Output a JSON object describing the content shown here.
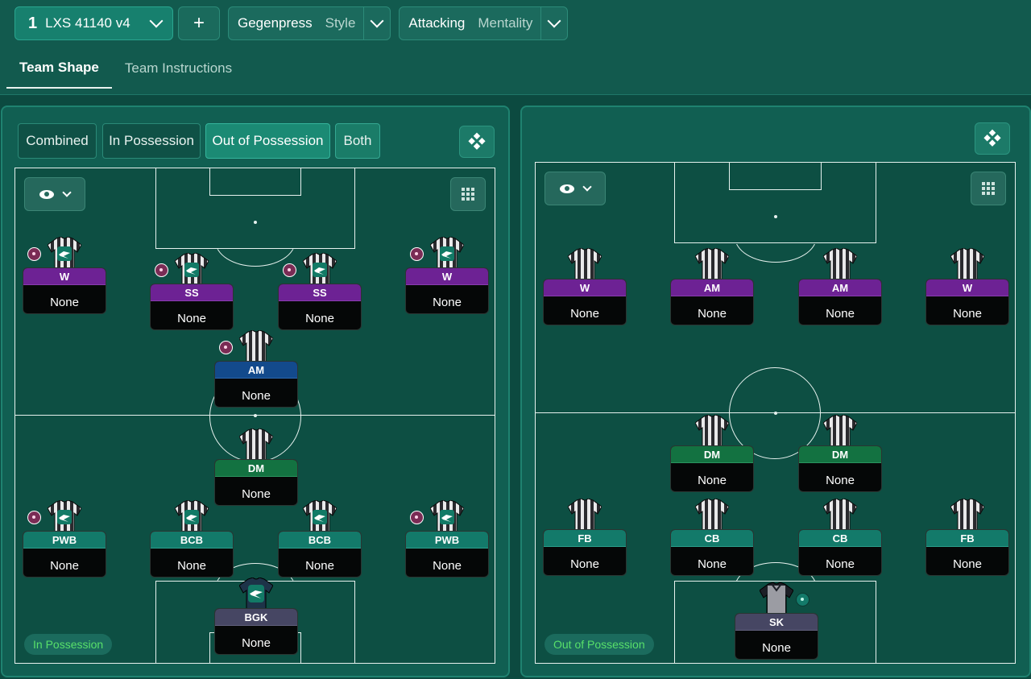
{
  "header": {
    "tactic": {
      "number": "1",
      "name": "LXS 41140 v4"
    },
    "add_label": "+",
    "style_dropdown": {
      "value": "Gegenpress",
      "label": "Style"
    },
    "mentality_dropdown": {
      "value": "Attacking",
      "label": "Mentality"
    },
    "tabs": [
      {
        "label": "Team Shape",
        "active": true
      },
      {
        "label": "Team Instructions",
        "active": false
      }
    ]
  },
  "left_panel": {
    "segments": [
      {
        "label": "Combined",
        "active": false
      },
      {
        "label": "In Possession",
        "active": false
      },
      {
        "label": "Out of Possession",
        "active": true
      },
      {
        "label": "Both",
        "active": false
      }
    ],
    "phase_label": "In Possession",
    "players": [
      {
        "role": "W",
        "duty": "None",
        "color": "purple"
      },
      {
        "role": "SS",
        "duty": "None",
        "color": "purple"
      },
      {
        "role": "SS",
        "duty": "None",
        "color": "purple"
      },
      {
        "role": "W",
        "duty": "None",
        "color": "purple"
      },
      {
        "role": "AM",
        "duty": "None",
        "color": "blue"
      },
      {
        "role": "DM",
        "duty": "None",
        "color": "green"
      },
      {
        "role": "PWB",
        "duty": "None",
        "color": "teal"
      },
      {
        "role": "BCB",
        "duty": "None",
        "color": "teal"
      },
      {
        "role": "BCB",
        "duty": "None",
        "color": "teal"
      },
      {
        "role": "PWB",
        "duty": "None",
        "color": "teal"
      },
      {
        "role": "BGK",
        "duty": "None",
        "color": "grey"
      }
    ]
  },
  "right_panel": {
    "phase_label": "Out of Possession",
    "players": [
      {
        "role": "W",
        "duty": "None",
        "color": "purple"
      },
      {
        "role": "AM",
        "duty": "None",
        "color": "purple"
      },
      {
        "role": "AM",
        "duty": "None",
        "color": "purple"
      },
      {
        "role": "W",
        "duty": "None",
        "color": "purple"
      },
      {
        "role": "DM",
        "duty": "None",
        "color": "green"
      },
      {
        "role": "DM",
        "duty": "None",
        "color": "green"
      },
      {
        "role": "FB",
        "duty": "None",
        "color": "teal"
      },
      {
        "role": "CB",
        "duty": "None",
        "color": "teal"
      },
      {
        "role": "CB",
        "duty": "None",
        "color": "teal"
      },
      {
        "role": "FB",
        "duty": "None",
        "color": "teal"
      },
      {
        "role": "SK",
        "duty": "None",
        "color": "grey"
      }
    ]
  },
  "colors": {
    "background": "#0c4a40",
    "panel": "#115f52",
    "pitch": "#0d4f43",
    "accent": "#1b8a74",
    "role_purple": "#6d2294",
    "role_blue": "#134a8c",
    "role_green": "#137241",
    "role_teal": "#137a6a",
    "role_grey": "#464663",
    "phase_text": "#58e06a"
  },
  "icons": {
    "tactic_dropdown": "chevron-down-icon",
    "view_toggle": "eye-icon",
    "layout_toggle": "grid-dots-icon",
    "rotate": "rotate-diamond-icon",
    "instruction_badge": "instruction-badge-icon",
    "player_shirt": "shirt-icon"
  }
}
